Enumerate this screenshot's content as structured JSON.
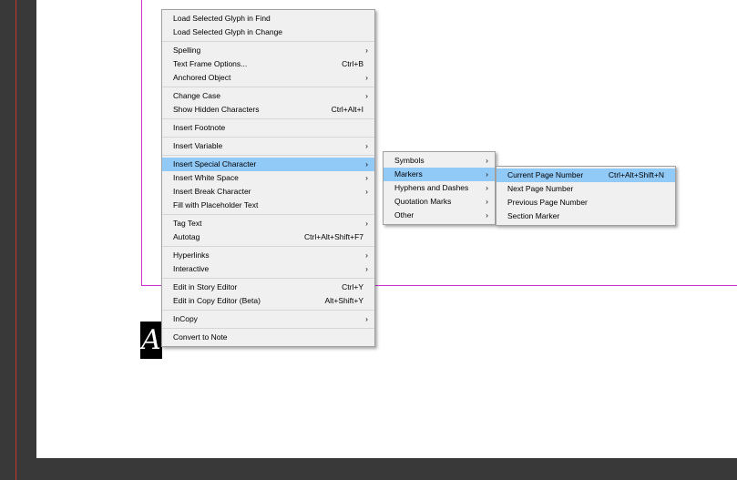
{
  "context_menu": {
    "groups": [
      [
        {
          "label": "Load Selected Glyph in Find",
          "shortcut": "",
          "submenu": false
        },
        {
          "label": "Load Selected Glyph in Change",
          "shortcut": "",
          "submenu": false
        }
      ],
      [
        {
          "label": "Spelling",
          "shortcut": "",
          "submenu": true
        },
        {
          "label": "Text Frame Options...",
          "shortcut": "Ctrl+B",
          "submenu": false
        },
        {
          "label": "Anchored Object",
          "shortcut": "",
          "submenu": true
        }
      ],
      [
        {
          "label": "Change Case",
          "shortcut": "",
          "submenu": true
        },
        {
          "label": "Show Hidden Characters",
          "shortcut": "Ctrl+Alt+I",
          "submenu": false
        }
      ],
      [
        {
          "label": "Insert Footnote",
          "shortcut": "",
          "submenu": false
        }
      ],
      [
        {
          "label": "Insert Variable",
          "shortcut": "",
          "submenu": true
        }
      ],
      [
        {
          "label": "Insert Special Character",
          "shortcut": "",
          "submenu": true,
          "active": true
        },
        {
          "label": "Insert White Space",
          "shortcut": "",
          "submenu": true
        },
        {
          "label": "Insert Break Character",
          "shortcut": "",
          "submenu": true
        },
        {
          "label": "Fill with Placeholder Text",
          "shortcut": "",
          "submenu": false
        }
      ],
      [
        {
          "label": "Tag Text",
          "shortcut": "",
          "submenu": true
        },
        {
          "label": "Autotag",
          "shortcut": "Ctrl+Alt+Shift+F7",
          "submenu": false
        }
      ],
      [
        {
          "label": "Hyperlinks",
          "shortcut": "",
          "submenu": true
        },
        {
          "label": "Interactive",
          "shortcut": "",
          "submenu": true
        }
      ],
      [
        {
          "label": "Edit in Story Editor",
          "shortcut": "Ctrl+Y",
          "submenu": false
        },
        {
          "label": "Edit in Copy Editor (Beta)",
          "shortcut": "Alt+Shift+Y",
          "submenu": false
        }
      ],
      [
        {
          "label": "InCopy",
          "shortcut": "",
          "submenu": true
        }
      ],
      [
        {
          "label": "Convert to Note",
          "shortcut": "",
          "submenu": false
        }
      ]
    ]
  },
  "special_character_menu": {
    "items": [
      {
        "label": "Symbols",
        "submenu": true
      },
      {
        "label": "Markers",
        "submenu": true,
        "active": true
      },
      {
        "label": "Hyphens and Dashes",
        "submenu": true
      },
      {
        "label": "Quotation Marks",
        "submenu": true
      },
      {
        "label": "Other",
        "submenu": true
      }
    ]
  },
  "markers_menu": {
    "items": [
      {
        "label": "Current Page Number",
        "shortcut": "Ctrl+Alt+Shift+N",
        "active": true
      },
      {
        "label": "Next Page Number",
        "shortcut": ""
      },
      {
        "label": "Previous Page Number",
        "shortcut": ""
      },
      {
        "label": "Section Marker",
        "shortcut": ""
      }
    ]
  },
  "story_marker": {
    "glyph": "A"
  },
  "arrow_glyph": "›",
  "colors": {
    "highlight": "#91c9f7",
    "menu_bg": "#f0f0f0",
    "guide": "#cc33cc",
    "pasteboard": "#393939"
  }
}
